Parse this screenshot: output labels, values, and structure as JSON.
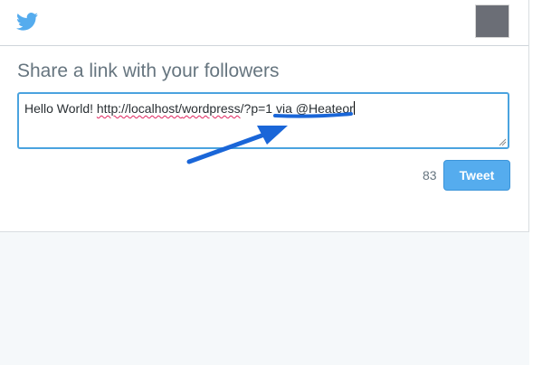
{
  "header": {
    "logo_icon": "twitter-bird-icon",
    "avatar_icon": "user-avatar",
    "brand_color": "#55acee"
  },
  "main": {
    "heading": "Share a link with your followers",
    "composer": {
      "text_prefix": "Hello World! ",
      "text_link_start": "http://localhost/",
      "text_link_word": "wordpress",
      "text_link_end": "/?p=1 via @",
      "text_handle": "Heateor"
    },
    "char_count": "83",
    "tweet_button_label": "Tweet"
  },
  "annotation": {
    "arrow_color": "#1a66d8",
    "arrow_icon": "pointer-arrow-icon"
  }
}
